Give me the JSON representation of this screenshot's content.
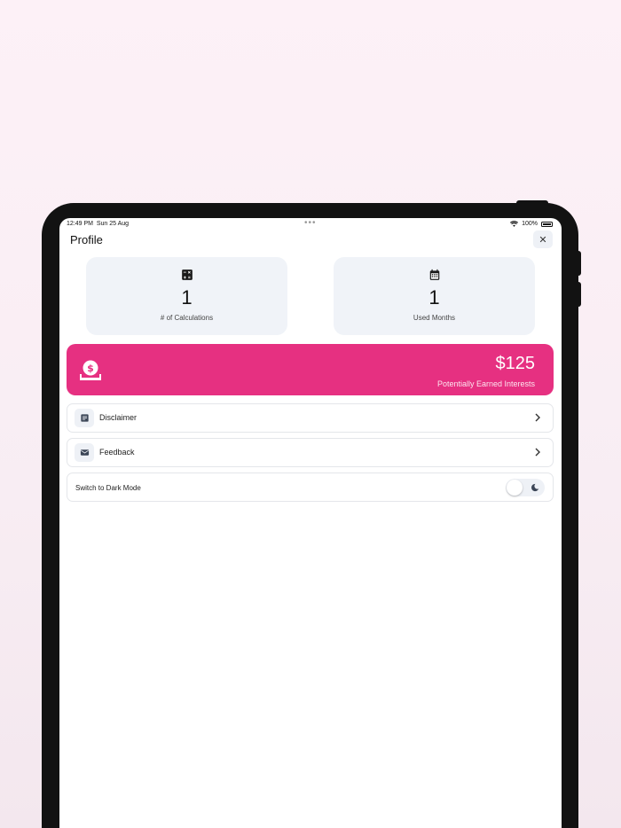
{
  "status": {
    "time": "12:49 PM",
    "date": "Sun 25 Aug",
    "dots": "•••",
    "battery": "100%"
  },
  "header": {
    "title": "Profile",
    "close_icon": "close-icon",
    "close_glyph": "✕"
  },
  "stats": [
    {
      "icon": "calculator-icon",
      "value": "1",
      "label": "# of Calculations"
    },
    {
      "icon": "calendar-icon",
      "value": "1",
      "label": "Used Months"
    }
  ],
  "interest": {
    "icon": "money-savings-icon",
    "amount": "$125",
    "caption": "Potentially Earned Interests",
    "color": "#e63081"
  },
  "menu": [
    {
      "icon": "document-icon",
      "label": "Disclaimer"
    },
    {
      "icon": "mail-icon",
      "label": "Feedback"
    }
  ],
  "dark_mode": {
    "label": "Switch to Dark Mode",
    "enabled": false,
    "icon": "moon-icon"
  }
}
